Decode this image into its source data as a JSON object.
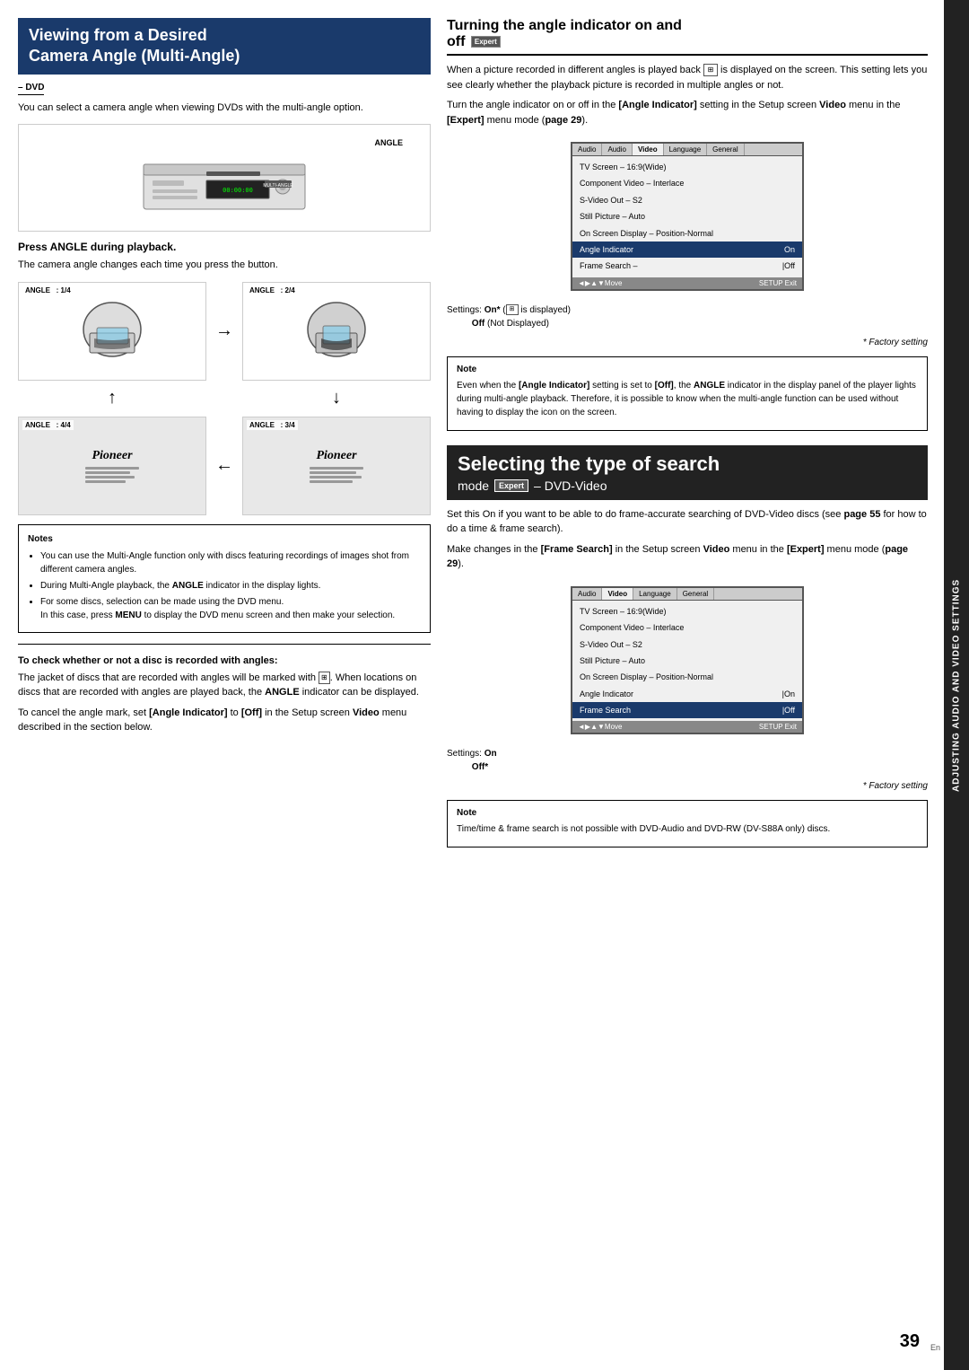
{
  "left": {
    "section1": {
      "title_line1": "Viewing from a Desired",
      "title_line2": "Camera Angle (Multi-Angle)",
      "dvd_label": "– DVD",
      "intro_text": "You can select a camera angle when viewing DVDs with the multi-angle option.",
      "angle_label": "ANGLE",
      "press_title": "Press ANGLE during playback.",
      "press_desc": "The camera angle changes each time you press the button.",
      "angle_cells": [
        {
          "label": "ANGLE   : 1/4",
          "content": "helmet"
        },
        {
          "label": "ANGLE   : 2/4",
          "content": "helmet2"
        },
        {
          "label": "ANGLE   : 4/4",
          "content": "pioneer"
        },
        {
          "label": "ANGLE   : 3/4",
          "content": "pioneer2"
        }
      ],
      "arrows": {
        "right": "→",
        "down": "↓",
        "left": "←",
        "up": "↑"
      },
      "notes": {
        "title": "Notes",
        "items": [
          "You can use the Multi-Angle function only with discs featuring recordings of images shot from different camera angles.",
          "During Multi-Angle playback, the ANGLE indicator in the display lights.",
          "For some discs, selection can be made using the DVD menu.\nIn this case, press MENU to display the DVD menu screen and then make your selection."
        ]
      }
    },
    "section2": {
      "title": "To check whether or not a disc is recorded with angles:",
      "desc1": "The jacket of discs that are recorded with angles will be marked with",
      "desc1b": ". When locations on discs that are recorded with angles are played back, the ANGLE indicator can be displayed.",
      "desc2": "To cancel the angle mark, set [Angle Indicator] to [Off] in the Setup screen Video menu described in the section below."
    }
  },
  "right": {
    "section1": {
      "title_line1": "Turning the angle indicator on and",
      "title_line2": "off",
      "expert_badge": "Expert",
      "para1": "When a picture recorded in different angles is played back",
      "icon_desc": "back icon",
      "para1b": "is displayed on the screen. This setting lets you see clearly whether the playback picture is recorded in multiple angles or not.",
      "para2": "Turn the angle indicator on or off in the [Angle Indicator] setting in the Setup screen Video menu in the [Expert] menu mode (page 29).",
      "settings_tabs": [
        "Audio",
        "Audio",
        "Video",
        "Language",
        "General"
      ],
      "settings_active_tab": "Video",
      "settings_rows": [
        {
          "label": "TV Screen – 16:9(Wide)",
          "value": ""
        },
        {
          "label": "Component Video – Interlace",
          "value": ""
        },
        {
          "label": "S-Video Out – S2",
          "value": ""
        },
        {
          "label": "Still Picture – Auto",
          "value": ""
        },
        {
          "label": "On Screen Display – Position-Normal",
          "value": ""
        },
        {
          "label": "Angle Indicator",
          "value": "On",
          "highlight": true
        },
        {
          "label": "Frame Search –",
          "value": "|Off"
        }
      ],
      "settings_footer_left": "◄▶▲▼Move",
      "settings_footer_right": "SETUP Exit",
      "settings_on_label": "Settings: On*",
      "settings_on_note": "is displayed",
      "settings_off_label": "Off (Not Displayed)",
      "factory_note": "* Factory setting",
      "note_title": "Note",
      "note_text": "Even when the [Angle Indicator] setting is set to [Off], the ANGLE indicator in the display panel of the player lights during multi-angle playback. Therefore, it is possible to know when the multi-angle function can be used without having to display the icon on the screen."
    },
    "section2": {
      "bg": "#222",
      "title": "Selecting the type of search",
      "subtitle_mode": "mode",
      "subtitle_expert": "Expert",
      "subtitle_rest": "– DVD-Video",
      "para1": "Set this On if you want to be able to do frame-accurate searching of DVD-Video discs (see page 55 for how to do a time & frame search).",
      "para2": "Make changes in the [Frame Search] in the Setup screen Video menu in the [Expert] menu mode (page 29).",
      "settings_tabs": [
        "Audio",
        "Video",
        "Language",
        "General"
      ],
      "settings_rows": [
        {
          "label": "TV Screen – 16:9(Wide)",
          "value": ""
        },
        {
          "label": "Component Video – Interlace",
          "value": ""
        },
        {
          "label": "S-Video Out – S2",
          "value": ""
        },
        {
          "label": "Still Picture – Auto",
          "value": ""
        },
        {
          "label": "On Screen Display – Position-Normal",
          "value": ""
        },
        {
          "label": "Angle Indicator",
          "value": "|On"
        },
        {
          "label": "Frame Search",
          "value": "|Off",
          "highlight": true
        }
      ],
      "settings_footer_left": "◄▶▲▼Move",
      "settings_footer_right": "SETUP Exit",
      "settings_on_label": "Settings: On",
      "settings_off_label": "Off*",
      "factory_note": "* Factory setting",
      "note_title": "Note",
      "note_text": "Time/time & frame search is not possible with DVD-Audio and DVD-RW (DV-S88A only) discs."
    }
  },
  "side_tab": "ADJUSTING AUDIO AND VIDEO SETTINGS",
  "page_number": "39",
  "en_label": "En"
}
